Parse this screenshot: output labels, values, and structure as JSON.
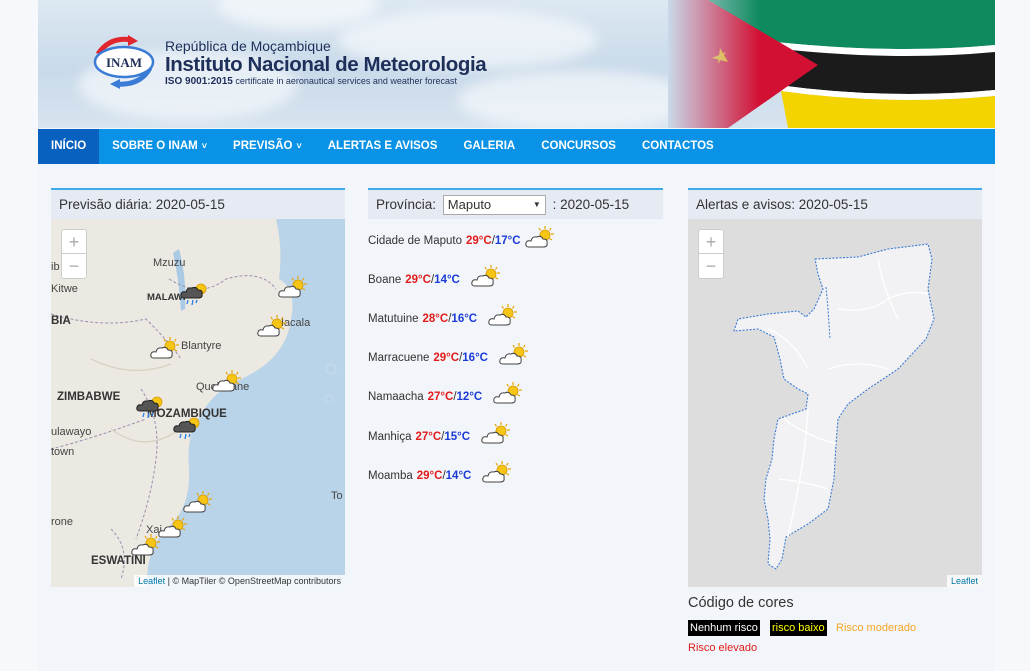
{
  "header": {
    "logo_text": "INAM",
    "republic": "República de Moçambique",
    "institute": "Instituto Nacional de Meteorologia",
    "iso_bold": "ISO 9001:2015",
    "iso_text": "certificate in aeronautical services and weather forecast"
  },
  "nav": {
    "items": [
      {
        "label": "INÍCIO",
        "active": true,
        "dropdown": false
      },
      {
        "label": "SOBRE O INAM",
        "active": false,
        "dropdown": true
      },
      {
        "label": "PREVISÃO",
        "active": false,
        "dropdown": true
      },
      {
        "label": "ALERTAS E AVISOS",
        "active": false,
        "dropdown": false
      },
      {
        "label": "GALERIA",
        "active": false,
        "dropdown": false
      },
      {
        "label": "CONCURSOS",
        "active": false,
        "dropdown": false
      },
      {
        "label": "CONTACTOS",
        "active": false,
        "dropdown": false
      }
    ],
    "caret": "˅"
  },
  "daily": {
    "title": "Previsão diária: 2020-05-15",
    "zoom_in": "+",
    "zoom_out": "−",
    "attribution_link": "Leaflet",
    "attribution_text": " | © MapTiler © OpenStreetMap contributors",
    "labels": {
      "mzuzu": "Mzuzu",
      "itwe": "Kitwe",
      "bia": "BIA",
      "malawi": "MALAWI",
      "blantyre": "Blantyre",
      "nacala": "Nacala",
      "quelimane": "Quelimane",
      "zimbabwe": "ZIMBABWE",
      "mozambique": "MOZAMBIQUE",
      "bulawayo": "ulawayo",
      "town": "town",
      "rone": "rone",
      "to": "To",
      "xai": "Xai",
      "eswatini": "ESWATINI",
      "lb": "ib"
    }
  },
  "province": {
    "label": "Província:",
    "selected": "Maputo",
    "date": ": 2020-05-15",
    "rows": [
      {
        "name": "Cidade de Maputo",
        "max": "29°C",
        "min": "17°C"
      },
      {
        "name": "Boane",
        "max": "29°C",
        "min": "14°C"
      },
      {
        "name": "Matutuine",
        "max": "28°C",
        "min": "16°C"
      },
      {
        "name": "Marracuene",
        "max": "29°C",
        "min": "16°C"
      },
      {
        "name": "Namaacha",
        "max": "27°C",
        "min": "12°C"
      },
      {
        "name": "Manhiça",
        "max": "27°C",
        "min": "15°C"
      },
      {
        "name": "Moamba",
        "max": "29°C",
        "min": "14°C"
      }
    ],
    "slash": "/"
  },
  "alerts": {
    "title": "Alertas e avisos: 2020-05-15",
    "zoom_in": "+",
    "zoom_out": "−",
    "attribution_link": "Leaflet"
  },
  "legend": {
    "title": "Código de cores",
    "none": "Nenhum risco",
    "low": "risco baixo",
    "moderate": "Risco moderado",
    "high": "Risco elevado"
  },
  "colors": {
    "nav_bg": "#0a93e6",
    "nav_active": "#0861bf",
    "temp_max": "#e21b1b",
    "temp_min": "#1b3bd8",
    "risk_none_bg": "#000000",
    "risk_low_bg": "#000000",
    "risk_low_text": "#ffff00",
    "risk_moderate": "#f5a623",
    "risk_high": "#e21b1b"
  },
  "icons": {
    "weather": "partly-cloudy-icon",
    "storm": "thunderstorm-icon"
  }
}
